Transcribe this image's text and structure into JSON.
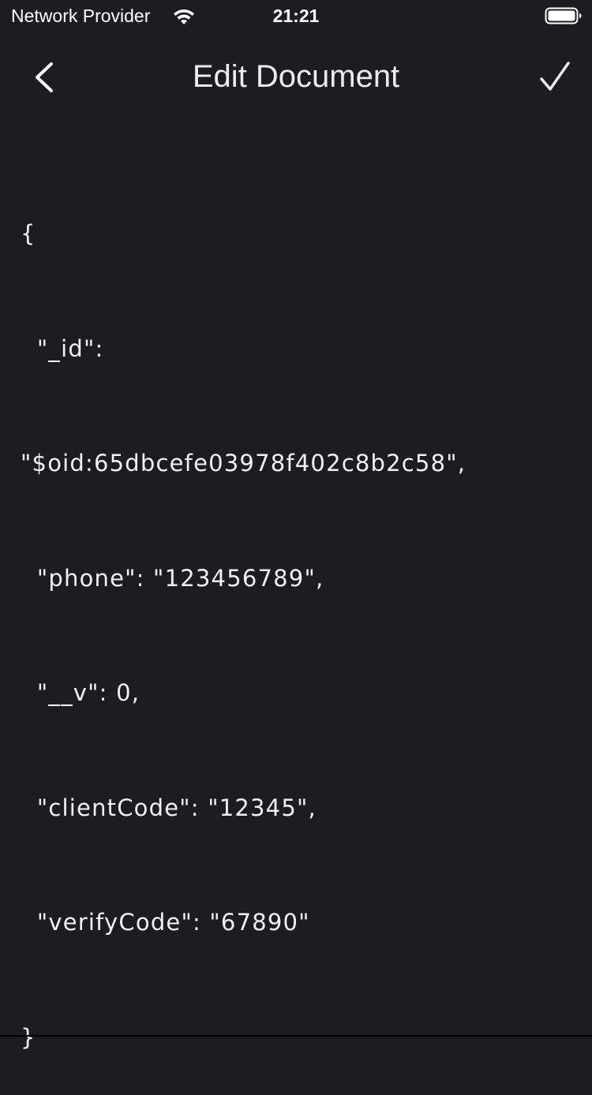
{
  "status_bar": {
    "carrier": "Network Provider",
    "time": "21:21",
    "wifi_icon": "wifi-icon",
    "battery_icon": "battery-full-icon"
  },
  "nav": {
    "title": "Edit Document",
    "back_icon": "chevron-left-icon",
    "done_icon": "checkmark-icon"
  },
  "editor": {
    "lines": [
      "{",
      "  \"_id\":",
      "\"$oid:65dbcefe03978f402c8b2c58\",",
      "  \"phone\": \"123456789\",",
      "  \"__v\": 0,",
      "  \"clientCode\": \"12345\",",
      "  \"verifyCode\": \"67890\"",
      "}"
    ]
  },
  "colors": {
    "background": "#1c1c21",
    "text": "#f2f2f2"
  }
}
